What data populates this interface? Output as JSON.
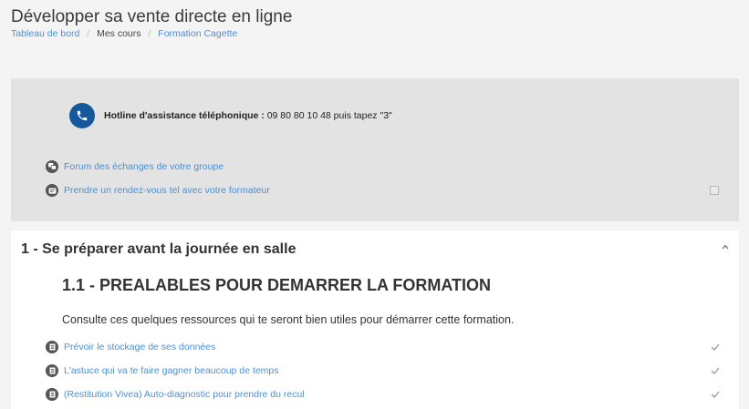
{
  "header": {
    "title": "Développer sa vente directe en ligne",
    "breadcrumb": [
      {
        "label": "Tableau de bord"
      },
      {
        "label": "Mes cours"
      },
      {
        "label": "Formation Cagette"
      }
    ],
    "breadcrumb_separator": "/"
  },
  "info_box": {
    "hotline_label": "Hotline d'assistance téléphonique :",
    "hotline_value": " 09 80 80 10 48 puis tapez \"3\"",
    "links": [
      {
        "label": "Forum des échanges de votre groupe",
        "icon": "forum-icon"
      },
      {
        "label": "Prendre un rendez-vous tel avec votre formateur",
        "icon": "scheduler-icon"
      }
    ],
    "icon": "phone-icon"
  },
  "section": {
    "title": "1 - Se préparer avant la journée en salle",
    "subtitle": "1.1 - PREALABLES POUR DEMARRER LA FORMATION",
    "description": "Consulte ces quelques ressources qui te seront bien utiles pour démarrer cette formation.",
    "activities": [
      {
        "label": "Prévoir le stockage de ses données",
        "icon": "page-icon",
        "completed": true
      },
      {
        "label": "L'astuce qui va te faire gagner beaucoup de temps",
        "icon": "page-icon",
        "completed": true
      },
      {
        "label": "(Restitution Vivea) Auto-diagnostic pour prendre du recul",
        "icon": "page-icon",
        "completed": true
      }
    ]
  },
  "colors": {
    "link": "#4a90d9",
    "phone_badge": "#15599c",
    "info_box_bg": "#e3e3e3",
    "page_bg": "#f4f4f5"
  }
}
